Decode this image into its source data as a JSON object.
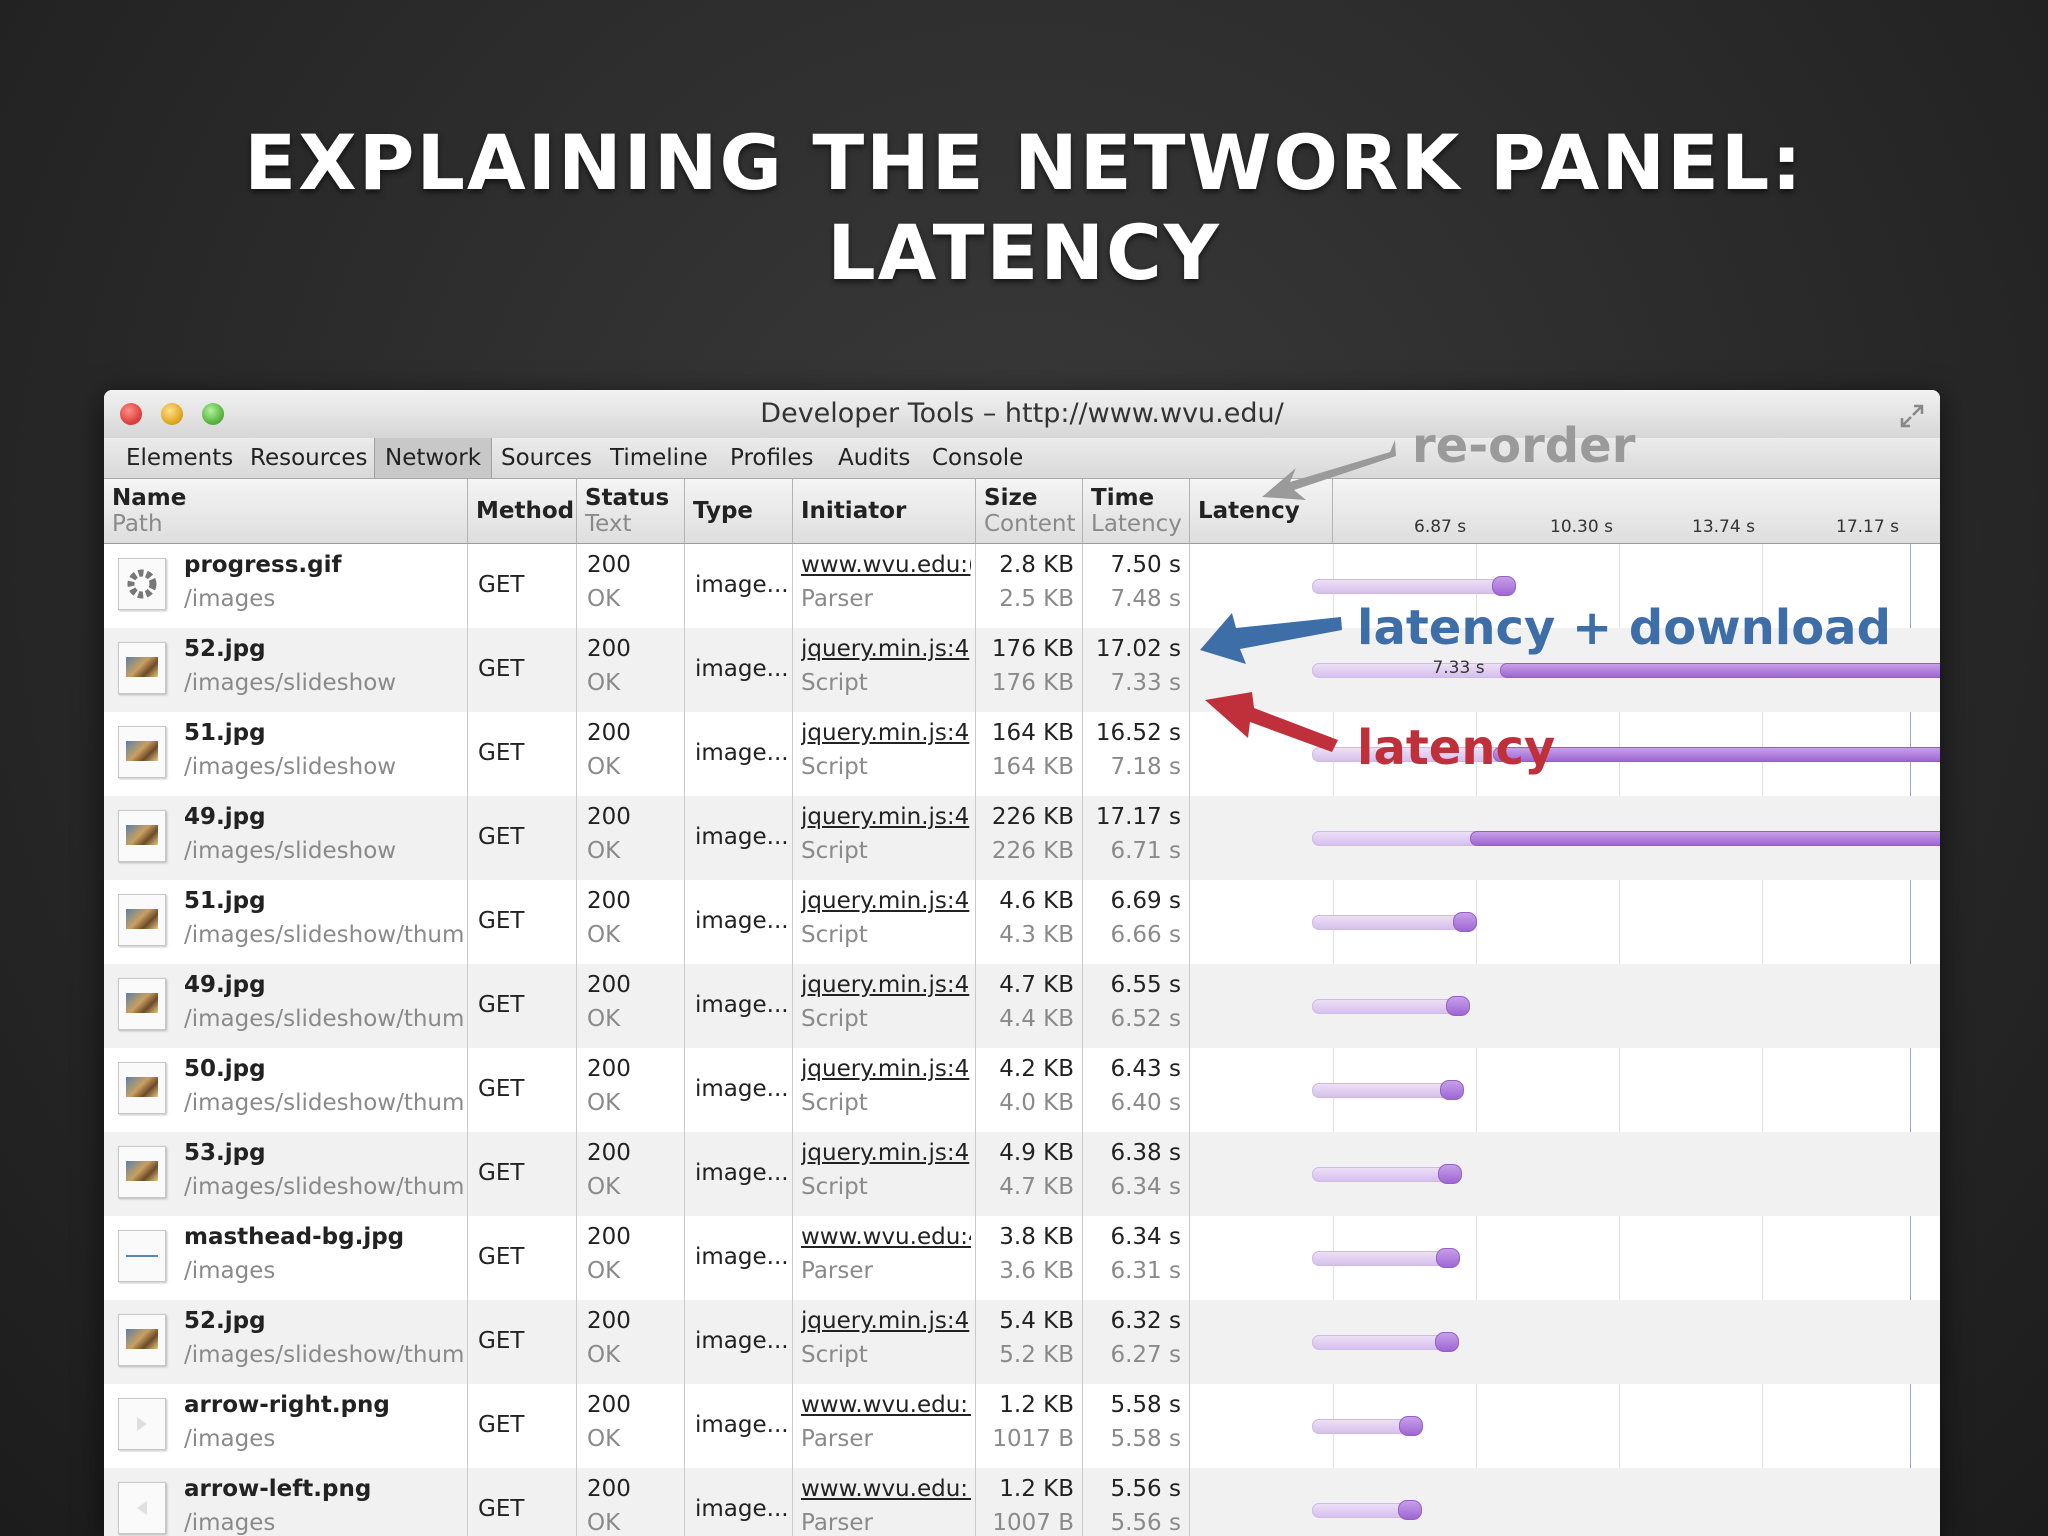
{
  "slide": {
    "title_line1": "EXPLAINING THE NETWORK PANEL:",
    "title_line2": "LATENCY"
  },
  "window": {
    "title": "Developer Tools – http://www.wvu.edu/",
    "tabs": [
      "Elements",
      "Resources",
      "Network",
      "Sources",
      "Timeline",
      "Profiles",
      "Audits",
      "Console"
    ],
    "active_tab": "Network"
  },
  "columns": {
    "name": "Name",
    "path": "Path",
    "method": "Method",
    "status": "Status",
    "status_sub": "Text",
    "type": "Type",
    "initiator": "Initiator",
    "size": "Size",
    "size_sub": "Content",
    "time": "Time",
    "time_sub": "Latency",
    "latency": "Latency"
  },
  "timeline_ticks": [
    "6.87 s",
    "10.30 s",
    "13.74 s",
    "17.17 s"
  ],
  "rows": [
    {
      "name": "progress.gif",
      "path": "/images",
      "method": "GET",
      "status": "200",
      "status_text": "OK",
      "type": "image...",
      "initiator": "www.wvu.edu:(",
      "initiator_type": "Parser",
      "size": "2.8 KB",
      "content": "2.5 KB",
      "time": "7.50 s",
      "latency": "7.48 s",
      "thumb": "spinner"
    },
    {
      "name": "52.jpg",
      "path": "/images/slideshow",
      "method": "GET",
      "status": "200",
      "status_text": "OK",
      "type": "image...",
      "initiator": "jquery.min.js:4",
      "initiator_type": "Script",
      "size": "176 KB",
      "content": "176 KB",
      "time": "17.02 s",
      "latency": "7.33 s",
      "thumb": "photo"
    },
    {
      "name": "51.jpg",
      "path": "/images/slideshow",
      "method": "GET",
      "status": "200",
      "status_text": "OK",
      "type": "image...",
      "initiator": "jquery.min.js:4",
      "initiator_type": "Script",
      "size": "164 KB",
      "content": "164 KB",
      "time": "16.52 s",
      "latency": "7.18 s",
      "thumb": "photo"
    },
    {
      "name": "49.jpg",
      "path": "/images/slideshow",
      "method": "GET",
      "status": "200",
      "status_text": "OK",
      "type": "image...",
      "initiator": "jquery.min.js:4",
      "initiator_type": "Script",
      "size": "226 KB",
      "content": "226 KB",
      "time": "17.17 s",
      "latency": "6.71 s",
      "thumb": "photo"
    },
    {
      "name": "51.jpg",
      "path": "/images/slideshow/thum",
      "method": "GET",
      "status": "200",
      "status_text": "OK",
      "type": "image...",
      "initiator": "jquery.min.js:4",
      "initiator_type": "Script",
      "size": "4.6 KB",
      "content": "4.3 KB",
      "time": "6.69 s",
      "latency": "6.66 s",
      "thumb": "photo"
    },
    {
      "name": "49.jpg",
      "path": "/images/slideshow/thum",
      "method": "GET",
      "status": "200",
      "status_text": "OK",
      "type": "image...",
      "initiator": "jquery.min.js:4",
      "initiator_type": "Script",
      "size": "4.7 KB",
      "content": "4.4 KB",
      "time": "6.55 s",
      "latency": "6.52 s",
      "thumb": "photo"
    },
    {
      "name": "50.jpg",
      "path": "/images/slideshow/thum",
      "method": "GET",
      "status": "200",
      "status_text": "OK",
      "type": "image...",
      "initiator": "jquery.min.js:4",
      "initiator_type": "Script",
      "size": "4.2 KB",
      "content": "4.0 KB",
      "time": "6.43 s",
      "latency": "6.40 s",
      "thumb": "photo"
    },
    {
      "name": "53.jpg",
      "path": "/images/slideshow/thum",
      "method": "GET",
      "status": "200",
      "status_text": "OK",
      "type": "image...",
      "initiator": "jquery.min.js:4",
      "initiator_type": "Script",
      "size": "4.9 KB",
      "content": "4.7 KB",
      "time": "6.38 s",
      "latency": "6.34 s",
      "thumb": "photo"
    },
    {
      "name": "masthead-bg.jpg",
      "path": "/images",
      "method": "GET",
      "status": "200",
      "status_text": "OK",
      "type": "image...",
      "initiator": "www.wvu.edu:4",
      "initiator_type": "Parser",
      "size": "3.8 KB",
      "content": "3.6 KB",
      "time": "6.34 s",
      "latency": "6.31 s",
      "thumb": "line"
    },
    {
      "name": "52.jpg",
      "path": "/images/slideshow/thum",
      "method": "GET",
      "status": "200",
      "status_text": "OK",
      "type": "image...",
      "initiator": "jquery.min.js:4",
      "initiator_type": "Script",
      "size": "5.4 KB",
      "content": "5.2 KB",
      "time": "6.32 s",
      "latency": "6.27 s",
      "thumb": "photo"
    },
    {
      "name": "arrow-right.png",
      "path": "/images",
      "method": "GET",
      "status": "200",
      "status_text": "OK",
      "type": "image...",
      "initiator": "www.wvu.edu:!",
      "initiator_type": "Parser",
      "size": "1.2 KB",
      "content": "1017 B",
      "time": "5.58 s",
      "latency": "5.58 s",
      "thumb": "arrow-right"
    },
    {
      "name": "arrow-left.png",
      "path": "/images",
      "method": "GET",
      "status": "200",
      "status_text": "OK",
      "type": "image...",
      "initiator": "www.wvu.edu:!",
      "initiator_type": "Parser",
      "size": "1.2 KB",
      "content": "1007 B",
      "time": "5.56 s",
      "latency": "5.56 s",
      "thumb": "arrow-left"
    }
  ],
  "bar_inline_label": "7.33 s",
  "annotations": {
    "reorder": "re-order",
    "latency_download": "latency + download",
    "latency": "latency"
  },
  "colors": {
    "reorder": "#9a9a9a",
    "latency_download": "#3d6ea8",
    "latency": "#c0303a",
    "bar_light": "#dcc8f0",
    "bar_dark": "#a872dc"
  }
}
